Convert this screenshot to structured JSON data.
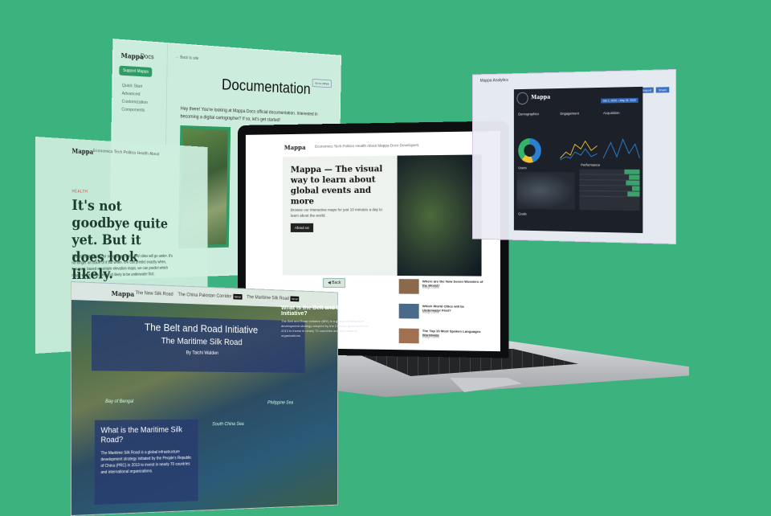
{
  "docs": {
    "brand": "Mappa",
    "nav_link": "Docs",
    "support_button": "Support Mappa",
    "sidebar_links": [
      "Quick Start",
      "Advanced Customization",
      "Components"
    ],
    "back_link": "← Back to site",
    "tag": "Go to Github",
    "title": "Documentation",
    "intro": "Hey there! You're looking at Mappa Docs official documentation. Interested in becoming a digital cartographer? If so, let's get started!"
  },
  "article": {
    "brand": "Mappa",
    "nav": "Economics  Tech  Politics  Health  About",
    "section": "HEALTH",
    "headline": "It's not goodbye quite yet. But it does look likely.",
    "body": "There's little doubt our oceans are rising and cities will go under. It's no longer an issue of if but when. We can predict exactly when, however, based on simple elevation maps, we can predict which major world cities are most likely to be underwater first."
  },
  "analytics": {
    "title": "Mappa Analytics",
    "tabs": [
      "Import",
      "Share"
    ],
    "dash_brand": "Mappa",
    "date_range": "Jan 1, 2020 – May 30, 2020",
    "demographics_label": "Demographics",
    "engagement_label": "Engagement",
    "acquisition_label": "Acquisition",
    "users_label": "Users",
    "performance_label": "Performance",
    "goals_label": "Goals"
  },
  "laptop": {
    "brand": "Mappa",
    "nav": "Economics  Tech  Politics  Health  About  Mappa  Docs  Developers",
    "hero_title": "Mappa — The visual way to learn about global events and more",
    "hero_sub": "Browse our interactive maps for just 10 minutes a day to learn about the world.",
    "about_button": "About us",
    "list": [
      {
        "title": "Where are the New Seven Wonders of the World?",
        "meta": "Margo Dafoe"
      },
      {
        "title": "Which World Cities will be Underwater First?",
        "meta": "Margo Dafoe"
      },
      {
        "title": "The Top 10 Most Spoken Languages Worldwide",
        "meta": "Margo Dafoe"
      }
    ]
  },
  "fragment": {
    "headline": "What is the Belt and Road Initiative?",
    "body": "The Belt and Road Initiative (BRI) is a global infrastructure development strategy adopted by the Chinese government in 2013 to invest in nearly 70 countries and international organizations."
  },
  "silk": {
    "brand": "Mappa",
    "nav_items": [
      "The New Silk Road",
      "The China Pakistan Corridor",
      "The Maritime Silk Road"
    ],
    "new_badge": "NEW",
    "back_button": "◀ Back",
    "title": "The Belt and Road Initiative",
    "subtitle": "The Maritime Silk Road",
    "byline": "By Taichi Walden",
    "info_heading": "What is the Maritime Silk Road?",
    "info_body": "The Maritime Silk Road is a global infrastructure development strategy initiated by the People's Republic of China (PRC) in 2013 to invest in nearly 70 countries and international organizations.",
    "sea_labels": [
      "Bay of Bengal",
      "South China Sea",
      "Philippine Sea"
    ]
  }
}
